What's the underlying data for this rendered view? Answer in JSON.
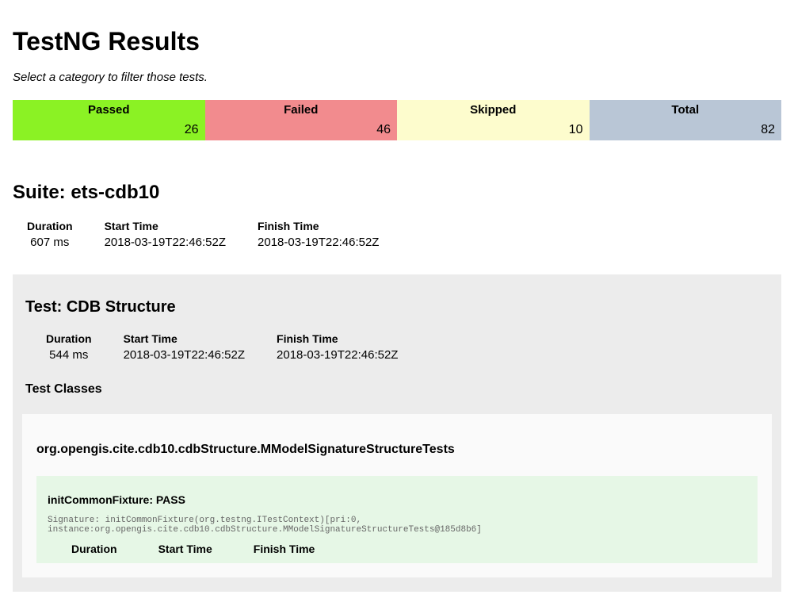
{
  "header": {
    "title": "TestNG Results",
    "subtitle": "Select a category to filter those tests."
  },
  "summary": {
    "passed_label": "Passed",
    "failed_label": "Failed",
    "skipped_label": "Skipped",
    "total_label": "Total",
    "passed": 26,
    "failed": 46,
    "skipped": 10,
    "total": 82
  },
  "suite": {
    "heading": "Suite: ets-cdb10",
    "meta_labels": {
      "duration": "Duration",
      "start": "Start Time",
      "finish": "Finish Time"
    },
    "duration": "607 ms",
    "start": "2018-03-19T22:46:52Z",
    "finish": "2018-03-19T22:46:52Z"
  },
  "test": {
    "heading": "Test: CDB Structure",
    "duration": "544 ms",
    "start": "2018-03-19T22:46:52Z",
    "finish": "2018-03-19T22:46:52Z",
    "classes_label": "Test Classes"
  },
  "test_class": {
    "heading": "org.opengis.cite.cdb10.cdbStructure.MModelSignatureStructureTests"
  },
  "result": {
    "heading": "initCommonFixture: PASS",
    "signature": "Signature: initCommonFixture(org.testng.ITestContext)[pri:0,\ninstance:org.opengis.cite.cdb10.cdbStructure.MModelSignatureStructureTests@185d8b6]"
  }
}
